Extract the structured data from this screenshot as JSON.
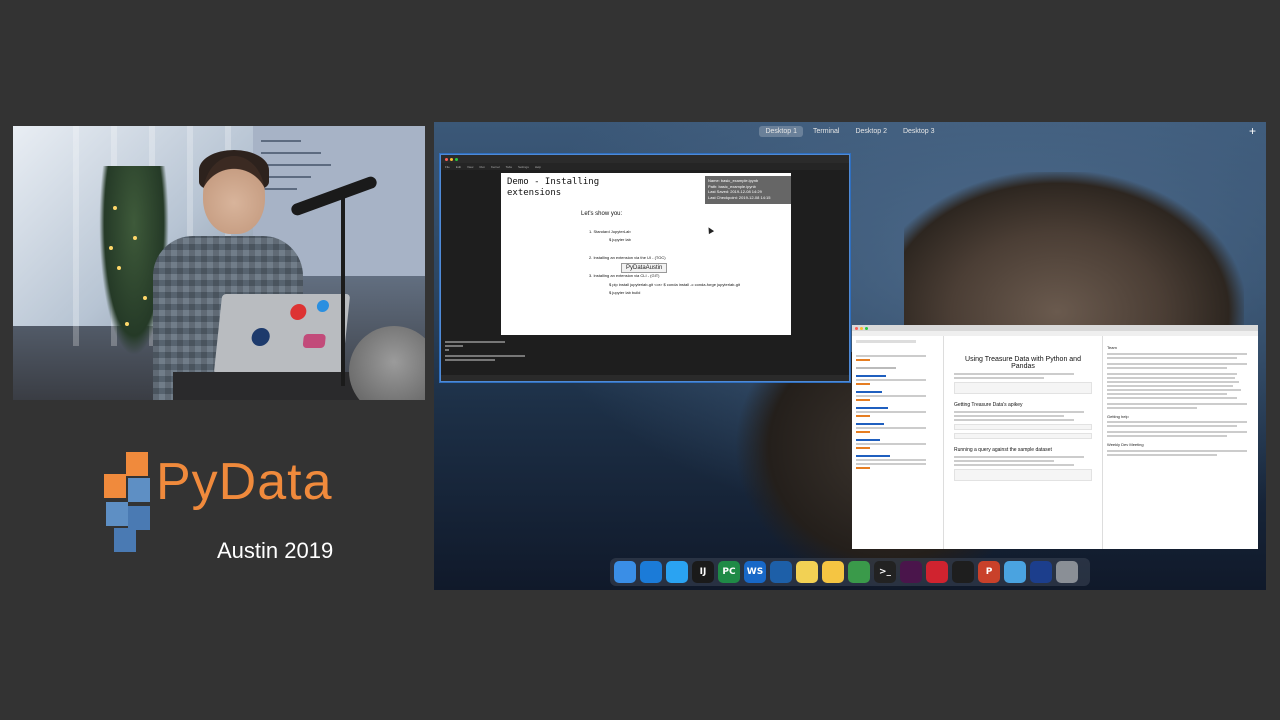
{
  "desktop": {
    "spaces": [
      "Desktop 1",
      "Terminal",
      "Desktop 2",
      "Desktop 3"
    ],
    "active_space": "Desktop 1",
    "add_label": "+"
  },
  "logo": {
    "name": "PyData",
    "event": "Austin 2019"
  },
  "jupyter": {
    "menu": [
      "File",
      "Edit",
      "View",
      "Run",
      "Kernel",
      "Tabs",
      "Settings",
      "Help"
    ],
    "slide": {
      "title": "Demo - Installing extensions",
      "intro": "Let's show you:",
      "items": [
        {
          "label": "1.  Standard JupyterLab",
          "code": "$ jupyter lab"
        },
        {
          "label": "2.  Installing an extension via the UI - (TOC)",
          "code": ""
        },
        {
          "label": "3.  Installing an extension via CLI - (GIT)",
          "code": "$ pip install jupyterlab-git <or> $ conda install -c conda-forge jupyterlab-git"
        },
        {
          "label": "",
          "code": "$ jupyter lab build"
        }
      ]
    },
    "tooltip": {
      "name": "Name: basic_example.ipynb",
      "path": "Path: basic_example.ipynb",
      "saved": "Last Saved: 2019-12-08 14:29",
      "checkpoint": "Last Checkpoint: 2019-12-08 14:15"
    },
    "hover_label": "PyDataAustin"
  },
  "notebook": {
    "title": "Using Treasure Data with Python and Pandas",
    "sections": [
      "Getting Treasure Data's apikey",
      "Running a query against the sample dataset"
    ],
    "right_headings": [
      "Team",
      "Getting help",
      "Weekly Dev Meeting"
    ]
  },
  "dock": {
    "apps": [
      {
        "name": "finder-icon",
        "label": "",
        "color": "#3a8ee6"
      },
      {
        "name": "safari-icon",
        "label": "",
        "color": "#1b7bd8"
      },
      {
        "name": "appstore-icon",
        "label": "",
        "color": "#2aa3f2"
      },
      {
        "name": "intellij-icon",
        "label": "IJ",
        "color": "#1a1a1a"
      },
      {
        "name": "pycharm-icon",
        "label": "PC",
        "color": "#1f8a46"
      },
      {
        "name": "webstorm-icon",
        "label": "WS",
        "color": "#1868c7"
      },
      {
        "name": "vscode-icon",
        "label": "",
        "color": "#1d5fa8"
      },
      {
        "name": "notes-icon",
        "label": "",
        "color": "#f2d154"
      },
      {
        "name": "stickies-icon",
        "label": "",
        "color": "#f5c542"
      },
      {
        "name": "chrome-icon",
        "label": "",
        "color": "#3a9a4a"
      },
      {
        "name": "terminal-icon",
        "label": ">_",
        "color": "#222222"
      },
      {
        "name": "slack-icon",
        "label": "",
        "color": "#4a154b"
      },
      {
        "name": "pocketcasts-icon",
        "label": "",
        "color": "#d0232f"
      },
      {
        "name": "activity-monitor-icon",
        "label": "",
        "color": "#1e1e1e"
      },
      {
        "name": "powerpoint-icon",
        "label": "P",
        "color": "#c9412a"
      },
      {
        "name": "folder-icon",
        "label": "",
        "color": "#4aa3e0"
      },
      {
        "name": "screen-icon",
        "label": "",
        "color": "#1c3e8c"
      },
      {
        "name": "trash-icon",
        "label": "",
        "color": "#8a8f96"
      }
    ]
  }
}
